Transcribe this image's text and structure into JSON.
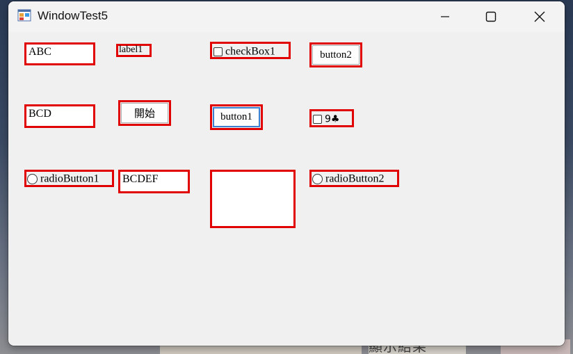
{
  "window": {
    "title": "WindowTest5",
    "minimize_icon": "minimize-icon",
    "maximize_icon": "maximize-icon",
    "close_icon": "close-icon"
  },
  "controls": {
    "textbox1": "ABC",
    "label1": "label1",
    "checkbox1": "checkBox1",
    "button2": "button2",
    "textbox2": "BCD",
    "start_button": "開始",
    "button1": "button1",
    "checkbox2": "9♣",
    "radiobutton1": "radioButton1",
    "textbox3": "BCDEF",
    "radiobutton2": "radioButton2"
  },
  "highlight_color": "#e00000",
  "background_fragment": "顯示結果"
}
